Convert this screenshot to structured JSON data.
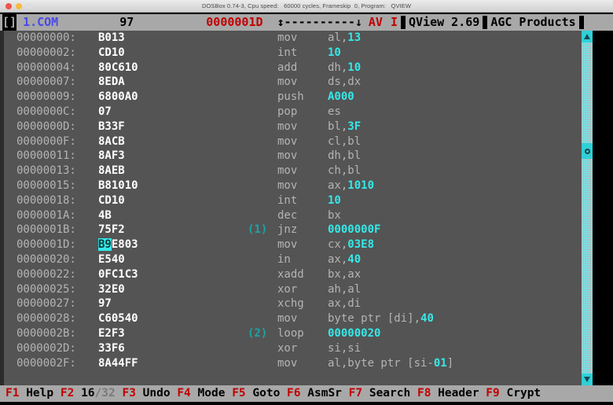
{
  "window": {
    "title": "DOSBox 0.74-3, Cpu speed:   60000 cycles, Frameskip  0, Program:   QVIEW",
    "traffic_lights": [
      "close-red",
      "minimize-yellow",
      "zoom-disabled"
    ]
  },
  "header": {
    "corner_glyph": "[]",
    "filename": "1.COM",
    "filesize": "97",
    "offset": "0000001D",
    "progress_glyph": "↕----------↓",
    "flags": "AV",
    "mode": "I",
    "app_name": "QView 2.69",
    "vendor": "AGC Products",
    "separator": "|"
  },
  "colors": {
    "accent_cyan": "#35e8e8",
    "scrollbar_cyan": "#2fd0d8",
    "header_red": "#c00000",
    "filename_blue": "#4a4ae8",
    "pane_bg": "#545454",
    "chrome_gray": "#a8a8a8",
    "byte_white": "#ffffff",
    "dim_gray": "#b4b4b4"
  },
  "listing": {
    "columns": [
      "address",
      "bytes",
      "marker",
      "mnemonic",
      "operands"
    ],
    "cursor_address": "0000001D",
    "cursor_bytes_highlighted": "B9",
    "rows": [
      {
        "addr": "00000000:",
        "bytes": "B013",
        "mark": "",
        "mnem": "mov",
        "opnd_pre": "al,",
        "opnd_num": "13",
        "opnd_post": ""
      },
      {
        "addr": "00000002:",
        "bytes": "CD10",
        "mark": "",
        "mnem": "int",
        "opnd_pre": "",
        "opnd_num": "10",
        "opnd_post": ""
      },
      {
        "addr": "00000004:",
        "bytes": "80C610",
        "mark": "",
        "mnem": "add",
        "opnd_pre": "dh,",
        "opnd_num": "10",
        "opnd_post": ""
      },
      {
        "addr": "00000007:",
        "bytes": "8EDA",
        "mark": "",
        "mnem": "mov",
        "opnd_pre": "ds,dx",
        "opnd_num": "",
        "opnd_post": ""
      },
      {
        "addr": "00000009:",
        "bytes": "6800A0",
        "mark": "",
        "mnem": "push",
        "opnd_pre": "",
        "opnd_num": "A000",
        "opnd_post": ""
      },
      {
        "addr": "0000000C:",
        "bytes": "07",
        "mark": "",
        "mnem": "pop",
        "opnd_pre": "es",
        "opnd_num": "",
        "opnd_post": ""
      },
      {
        "addr": "0000000D:",
        "bytes": "B33F",
        "mark": "",
        "mnem": "mov",
        "opnd_pre": "bl,",
        "opnd_num": "3F",
        "opnd_post": ""
      },
      {
        "addr": "0000000F:",
        "bytes": "8ACB",
        "mark": "",
        "mnem": "mov",
        "opnd_pre": "cl,bl",
        "opnd_num": "",
        "opnd_post": ""
      },
      {
        "addr": "00000011:",
        "bytes": "8AF3",
        "mark": "",
        "mnem": "mov",
        "opnd_pre": "dh,bl",
        "opnd_num": "",
        "opnd_post": ""
      },
      {
        "addr": "00000013:",
        "bytes": "8AEB",
        "mark": "",
        "mnem": "mov",
        "opnd_pre": "ch,bl",
        "opnd_num": "",
        "opnd_post": ""
      },
      {
        "addr": "00000015:",
        "bytes": "B81010",
        "mark": "",
        "mnem": "mov",
        "opnd_pre": "ax,",
        "opnd_num": "1010",
        "opnd_post": ""
      },
      {
        "addr": "00000018:",
        "bytes": "CD10",
        "mark": "",
        "mnem": "int",
        "opnd_pre": "",
        "opnd_num": "10",
        "opnd_post": ""
      },
      {
        "addr": "0000001A:",
        "bytes": "4B",
        "mark": "",
        "mnem": "dec",
        "opnd_pre": "bx",
        "opnd_num": "",
        "opnd_post": ""
      },
      {
        "addr": "0000001B:",
        "bytes": "75F2",
        "mark": "(1)",
        "mnem": "jnz",
        "opnd_pre": "",
        "opnd_num": "0000000F",
        "opnd_post": ""
      },
      {
        "addr": "0000001D:",
        "bytes": "B9E803",
        "mark": "",
        "mnem": "mov",
        "opnd_pre": "cx,",
        "opnd_num": "03E8",
        "opnd_post": ""
      },
      {
        "addr": "00000020:",
        "bytes": "E540",
        "mark": "",
        "mnem": "in",
        "opnd_pre": "ax,",
        "opnd_num": "40",
        "opnd_post": ""
      },
      {
        "addr": "00000022:",
        "bytes": "0FC1C3",
        "mark": "",
        "mnem": "xadd",
        "opnd_pre": "bx,ax",
        "opnd_num": "",
        "opnd_post": ""
      },
      {
        "addr": "00000025:",
        "bytes": "32E0",
        "mark": "",
        "mnem": "xor",
        "opnd_pre": "ah,al",
        "opnd_num": "",
        "opnd_post": ""
      },
      {
        "addr": "00000027:",
        "bytes": "97",
        "mark": "",
        "mnem": "xchg",
        "opnd_pre": "ax,di",
        "opnd_num": "",
        "opnd_post": ""
      },
      {
        "addr": "00000028:",
        "bytes": "C60540",
        "mark": "",
        "mnem": "mov",
        "opnd_pre": "byte ptr [di],",
        "opnd_num": "40",
        "opnd_post": ""
      },
      {
        "addr": "0000002B:",
        "bytes": "E2F3",
        "mark": "(2)",
        "mnem": "loop",
        "opnd_pre": "",
        "opnd_num": "00000020",
        "opnd_post": ""
      },
      {
        "addr": "0000002D:",
        "bytes": "33F6",
        "mark": "",
        "mnem": "xor",
        "opnd_pre": "si,si",
        "opnd_num": "",
        "opnd_post": ""
      },
      {
        "addr": "0000002F:",
        "bytes": "8A44FF",
        "mark": "",
        "mnem": "mov",
        "opnd_pre": "al,byte ptr [si-",
        "opnd_num": "01",
        "opnd_post": "]"
      }
    ]
  },
  "scrollbar": {
    "up_arrow": "scroll-up-arrow",
    "down_arrow": "scroll-down-arrow",
    "thumb_position_percent": 32
  },
  "fkeys": [
    {
      "key": "F1",
      "label": "Help"
    },
    {
      "key": "F2",
      "label": "16",
      "label_dim": "/32"
    },
    {
      "key": "F3",
      "label": "Undo"
    },
    {
      "key": "F4",
      "label": "Mode"
    },
    {
      "key": "F5",
      "label": "Goto"
    },
    {
      "key": "F6",
      "label": "AsmSr"
    },
    {
      "key": "F7",
      "label": "Search"
    },
    {
      "key": "F8",
      "label": "Header"
    },
    {
      "key": "F9",
      "label": "Crypt"
    }
  ]
}
